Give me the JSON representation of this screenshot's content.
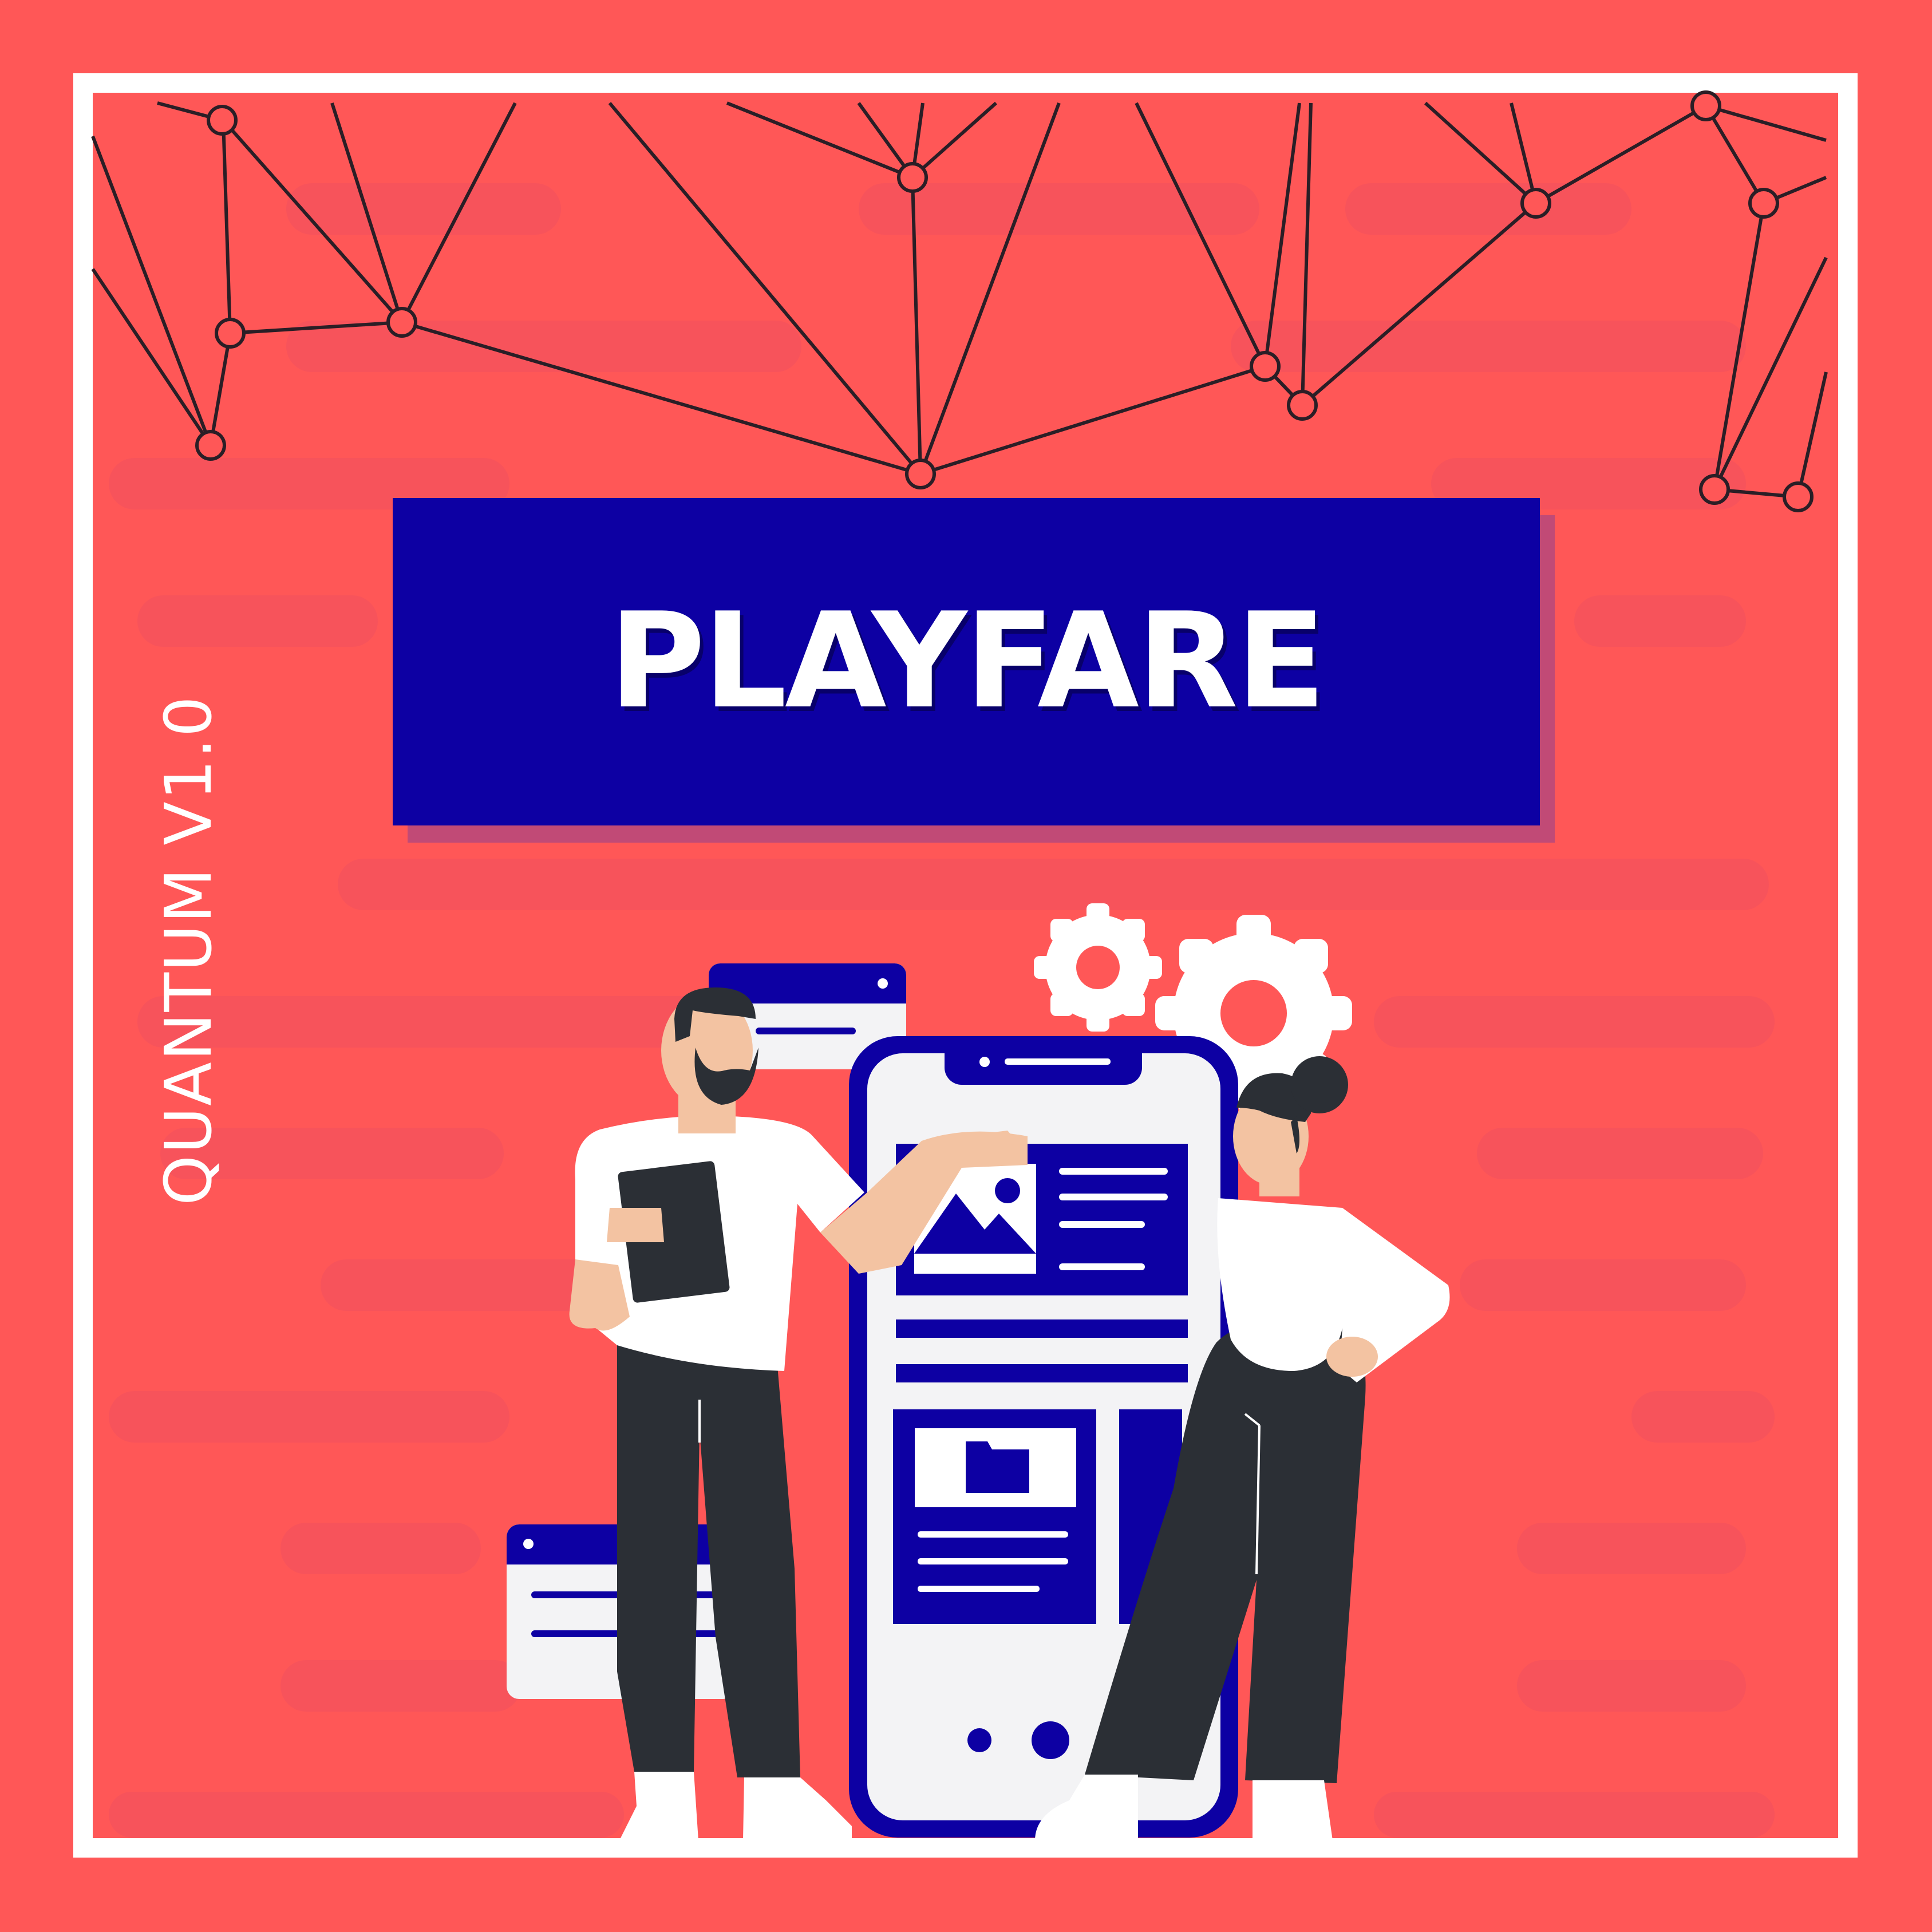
{
  "banner": {
    "title": "PLAYFARE"
  },
  "side_label": "QUANTUM V1.0",
  "colors": {
    "background": "#ff5757",
    "frame": "#ffffff",
    "banner": "#0d00a3",
    "banner_shadow": "#c14a76",
    "dark": "#2b2f35",
    "skin": "#f3c3a2",
    "panel": "#f3f3f5"
  },
  "illustration": {
    "subject": "two people presenting a mobile app",
    "elements": [
      "network-lines",
      "gear-icon",
      "phone-mockup",
      "browser-window",
      "image-icon",
      "folder-icon"
    ]
  }
}
